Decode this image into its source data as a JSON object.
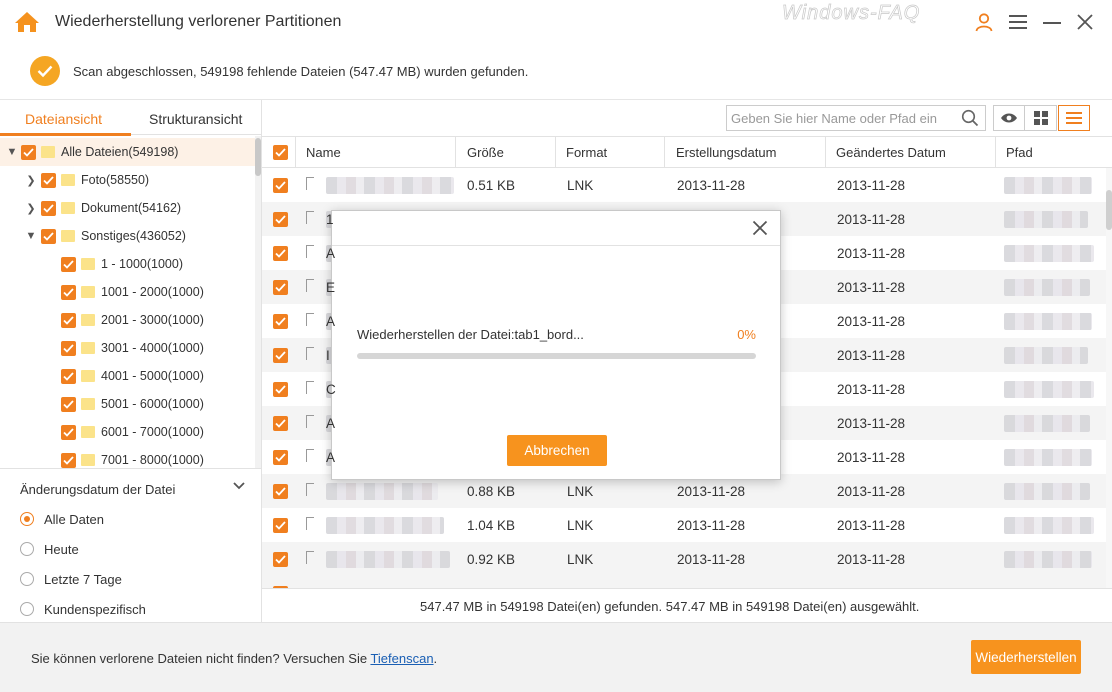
{
  "window": {
    "title": "Wiederherstellung verlorener Partitionen",
    "watermark": "Windows-FAQ",
    "accent_color": "#f07f1f",
    "buttons": [
      "user-icon",
      "menu-icon",
      "minimize-icon",
      "close-icon"
    ]
  },
  "scan": {
    "message": "Scan abgeschlossen, 549198 fehlende Dateien (547.47 MB) wurden gefunden."
  },
  "sidebar": {
    "tabs": [
      {
        "label": "Dateiansicht",
        "active": true
      },
      {
        "label": "Strukturansicht",
        "active": false
      }
    ],
    "tree": [
      {
        "label": "Alle Dateien(549198)",
        "level": 0,
        "expanded": true,
        "selected": true
      },
      {
        "label": "Foto(58550)",
        "level": 1,
        "expanded": false
      },
      {
        "label": "Dokument(54162)",
        "level": 1,
        "expanded": false
      },
      {
        "label": "Sonstiges(436052)",
        "level": 1,
        "expanded": true
      },
      {
        "label": "1 - 1000(1000)",
        "level": 2
      },
      {
        "label": "1001 - 2000(1000)",
        "level": 2
      },
      {
        "label": "2001 - 3000(1000)",
        "level": 2
      },
      {
        "label": "3001 - 4000(1000)",
        "level": 2
      },
      {
        "label": "4001 - 5000(1000)",
        "level": 2
      },
      {
        "label": "5001 - 6000(1000)",
        "level": 2
      },
      {
        "label": "6001 - 7000(1000)",
        "level": 2
      },
      {
        "label": "7001 - 8000(1000)",
        "level": 2
      }
    ],
    "filter": {
      "title": "Änderungsdatum der Datei",
      "options": [
        {
          "label": "Alle Daten",
          "selected": true
        },
        {
          "label": "Heute",
          "selected": false
        },
        {
          "label": "Letzte 7 Tage",
          "selected": false
        },
        {
          "label": "Kundenspezifisch",
          "selected": false
        }
      ]
    }
  },
  "toolbar": {
    "search_placeholder": "Geben Sie hier Name oder Pfad ein",
    "views": [
      "eye-icon",
      "grid-icon",
      "list-icon"
    ]
  },
  "table": {
    "columns": [
      "Name",
      "Größe",
      "Format",
      "Erstellungsdatum",
      "Geändertes Datum",
      "Pfad"
    ],
    "rows": [
      {
        "name_char": "",
        "size": "0.51 KB",
        "format": "LNK",
        "created": "2013-11-28",
        "modified": "2013-11-28"
      },
      {
        "name_char": "1",
        "size": "",
        "format": "",
        "created": "",
        "modified": "2013-11-28"
      },
      {
        "name_char": "A",
        "size": "",
        "format": "",
        "created": "",
        "modified": "2013-11-28"
      },
      {
        "name_char": "E",
        "size": "",
        "format": "",
        "created": "",
        "modified": "2013-11-28"
      },
      {
        "name_char": "A",
        "size": "",
        "format": "",
        "created": "",
        "modified": "2013-11-28"
      },
      {
        "name_char": "I",
        "size": "",
        "format": "",
        "created": "",
        "modified": "2013-11-28"
      },
      {
        "name_char": "C",
        "size": "",
        "format": "",
        "created": "",
        "modified": "2013-11-28"
      },
      {
        "name_char": "A",
        "size": "",
        "format": "",
        "created": "",
        "modified": "2013-11-28"
      },
      {
        "name_char": "A",
        "size": "",
        "format": "",
        "created": "",
        "modified": "2013-11-28"
      },
      {
        "name_char": "",
        "size": "0.88 KB",
        "format": "LNK",
        "created": "2013-11-28",
        "modified": "2013-11-28"
      },
      {
        "name_char": "",
        "size": "1.04 KB",
        "format": "LNK",
        "created": "2013-11-28",
        "modified": "2013-11-28"
      },
      {
        "name_char": "",
        "size": "0.92 KB",
        "format": "LNK",
        "created": "2013-11-28",
        "modified": "2013-11-28"
      }
    ]
  },
  "status": {
    "summary": "547.47 MB in 549198 Datei(en) gefunden. 547.47 MB in 549198 Datei(en) ausgewählt."
  },
  "footer": {
    "hint": "Sie können verlorene Dateien nicht finden? Versuchen Sie ",
    "link": "Tiefenscan",
    "hint_end": ".",
    "recover_label": "Wiederherstellen"
  },
  "dialog": {
    "label": "Wiederherstellen der Datei:tab1_bord...",
    "percent_label": "0%",
    "progress": 0,
    "cancel_label": "Abbrechen"
  }
}
